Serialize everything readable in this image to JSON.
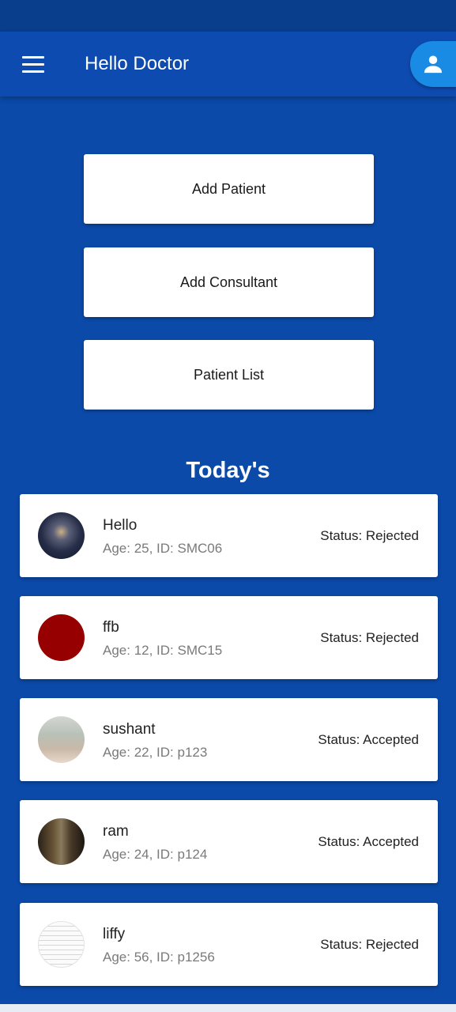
{
  "header": {
    "title": "Hello Doctor"
  },
  "actions": [
    "Add Patient",
    "Add Consultant",
    "Patient List"
  ],
  "section_title": "Today's",
  "patients": [
    {
      "name": "Hello",
      "meta": "Age: 25, ID: SMC06",
      "status": "Status: Rejected"
    },
    {
      "name": "ffb",
      "meta": "Age: 12, ID: SMC15",
      "status": "Status: Rejected"
    },
    {
      "name": "sushant",
      "meta": "Age: 22, ID: p123",
      "status": "Status: Accepted"
    },
    {
      "name": "ram",
      "meta": "Age: 24, ID: p124",
      "status": "Status: Accepted"
    },
    {
      "name": "liffy",
      "meta": "Age: 56, ID: p1256",
      "status": "Status: Rejected"
    }
  ],
  "colors": {
    "background": "#0b4aa9",
    "app_bar": "#0d4bb0",
    "profile_button": "#1a8be4"
  },
  "icons": {
    "menu": "hamburger-menu-icon",
    "profile": "person-icon"
  }
}
